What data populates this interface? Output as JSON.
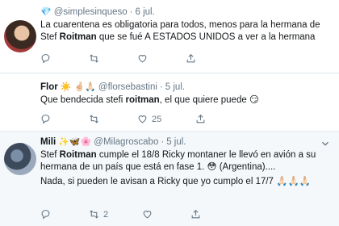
{
  "tweets": [
    {
      "name": "",
      "badge": "💎",
      "handle": "@simplesinqueso",
      "date": "6 jul.",
      "text_pre": "La cuarentena es obligatoria para todos, menos para la hermana de Stef ",
      "text_bold": "Roitman",
      "text_post": " que se fué A ESTADOS UNIDOS a ver a la hermana",
      "reply_count": "",
      "retweet_count": "",
      "like_count": ""
    },
    {
      "name": "Flor",
      "emojis": "☀️ 🤞🏻🙏🏻",
      "handle": "@florsebastini",
      "date": "5 jul.",
      "text_pre": "Que bendecida stefi ",
      "text_bold": "roitman",
      "text_post": ", el que quiere puede 😏",
      "reply_count": "",
      "retweet_count": "",
      "like_count": "25"
    },
    {
      "name": "Mili",
      "emojis": "✨🦋🌸",
      "handle": "@Milagroscabo",
      "date": "5 jul.",
      "text_pre": "Stef ",
      "text_bold": "Roitman",
      "text_post": " cumple el 18/8 Ricky montaner le llevó en avión a su hermana de un país que está en fase 1. 😳 (Argentina)....",
      "text_line2": "Nada, si pueden le avisan a Ricky que yo cumplo el 17/7 🙏🏻🙏🏻🙏🏻",
      "reply_count": "",
      "retweet_count": "2",
      "like_count": ""
    }
  ],
  "colors": {
    "meta": "#657786",
    "divider": "#e1e8ed",
    "highlight_bg": "#f5f8fa"
  }
}
